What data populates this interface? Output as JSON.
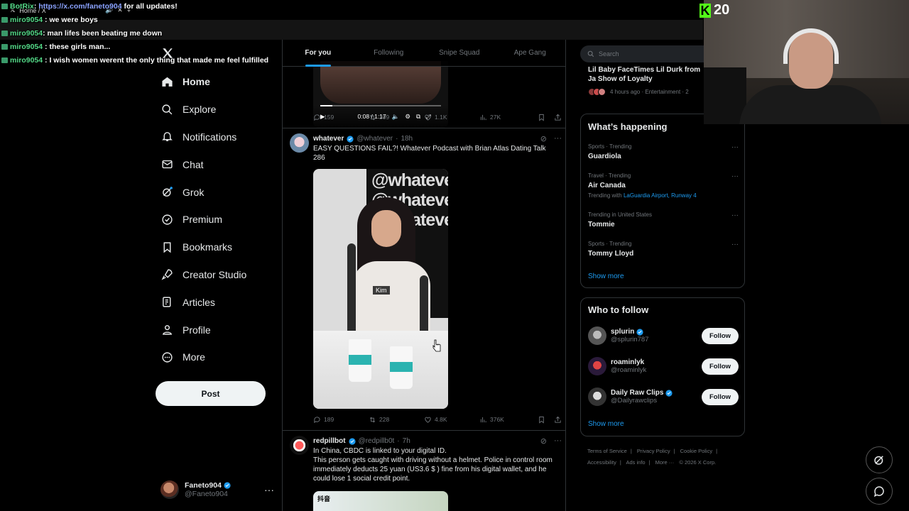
{
  "browser": {
    "tab_title": "Home / X"
  },
  "chat": [
    {
      "user": "BotRix",
      "sep": ": ",
      "msg_prefix": "",
      "link": "https://x.com/faneto904",
      "msg": " for all updates!"
    },
    {
      "user": "miro9054",
      "sep": " : ",
      "msg_prefix": "",
      "link": "",
      "msg": "we were boys"
    },
    {
      "user": "miro9054",
      "sep": ": ",
      "msg_prefix": "",
      "link": "",
      "msg": "man lifes been beating me down"
    },
    {
      "user": "miro9054",
      "sep": " : ",
      "msg_prefix": "",
      "link": "",
      "msg": "these girls man..."
    },
    {
      "user": "miro9054",
      "sep": " : ",
      "msg_prefix": "",
      "link": "",
      "msg": "I wish women werent the only thing that made me feel fulfilled"
    }
  ],
  "sidebar": {
    "items": [
      {
        "label": "Home",
        "icon": "home-icon"
      },
      {
        "label": "Explore",
        "icon": "search-icon"
      },
      {
        "label": "Notifications",
        "icon": "bell-icon"
      },
      {
        "label": "Chat",
        "icon": "mail-icon"
      },
      {
        "label": "Grok",
        "icon": "grok-icon"
      },
      {
        "label": "Premium",
        "icon": "premium-icon"
      },
      {
        "label": "Bookmarks",
        "icon": "bookmark-icon"
      },
      {
        "label": "Creator Studio",
        "icon": "rocket-icon"
      },
      {
        "label": "Articles",
        "icon": "article-icon"
      },
      {
        "label": "Profile",
        "icon": "person-icon"
      },
      {
        "label": "More",
        "icon": "more-circle-icon"
      }
    ],
    "post_label": "Post",
    "account": {
      "name": "Faneto904",
      "handle": "@Faneto904"
    }
  },
  "timeline": {
    "tabs": [
      "For you",
      "Following",
      "Snipe Squad",
      "Ape Gang"
    ],
    "active_tab": "For you",
    "video": {
      "time": "0:08 / 1:17",
      "progress": 0.1
    },
    "tweet0_stats": {
      "replies": "159",
      "reposts": "309",
      "likes": "1.1K",
      "views": "27K"
    },
    "tweet1": {
      "name": "whatever",
      "handle": "@whatever",
      "time": "18h",
      "text": "EASY QUESTIONS FAIL?! Whatever Podcast with Brian Atlas Dating Talk 286",
      "caption": "Kim",
      "watermark": "@whatever",
      "stats": {
        "replies": "189",
        "reposts": "228",
        "likes": "4.8K",
        "views": "376K"
      }
    },
    "tweet2": {
      "name": "redpillbot",
      "handle": "@redpillb0t",
      "time": "7h",
      "text": "In China, CBDC is linked to your digital ID.\nThis person gets caught with driving without a helmet. Police in control room immediately deducts 25 yuan (US3.6 $ ) fine from his digital wallet, and he could lose 1 social credit point.",
      "media_label": "抖音"
    }
  },
  "right": {
    "search_placeholder": "Search",
    "top_news": {
      "title": "Lil Baby FaceTimes Lil Durk from Ja Show of Loyalty",
      "meta": "4 hours ago · Entertainment · 2"
    },
    "happening_title": "What’s happening",
    "trends": [
      {
        "category": "Sports · Trending",
        "name": "Guardiola",
        "with_label": "",
        "with": ""
      },
      {
        "category": "Travel · Trending",
        "name": "Air Canada",
        "with_label": "Trending with",
        "with": "LaGuardia Airport, Runway 4"
      },
      {
        "category": "Trending in United States",
        "name": "Tommie",
        "with_label": "",
        "with": ""
      },
      {
        "category": "Sports · Trending",
        "name": "Tommy Lloyd",
        "with_label": "",
        "with": ""
      }
    ],
    "show_more": "Show more",
    "follow_title": "Who to follow",
    "follow": [
      {
        "name": "splurin",
        "handle": "@splurin787",
        "verified": true
      },
      {
        "name": "roaminlyk",
        "handle": "@roaminlyk",
        "verified": false
      },
      {
        "name": "Daily Raw Clips",
        "handle": "@Dailyrawclips",
        "verified": true
      }
    ],
    "follow_label": "Follow",
    "footer": [
      "Terms of Service",
      "|",
      "Privacy Policy",
      "|",
      "Cookie Policy",
      "|",
      "Accessibility",
      "|",
      "Ads info",
      "|",
      "More ···",
      "© 2026 X Corp."
    ]
  },
  "overlay": {
    "kick_count": "20",
    "accent": "#53fc18"
  },
  "colors": {
    "accent": "#1d9bf0",
    "bg": "#000000",
    "border": "#2f3336",
    "muted": "#71767b"
  }
}
